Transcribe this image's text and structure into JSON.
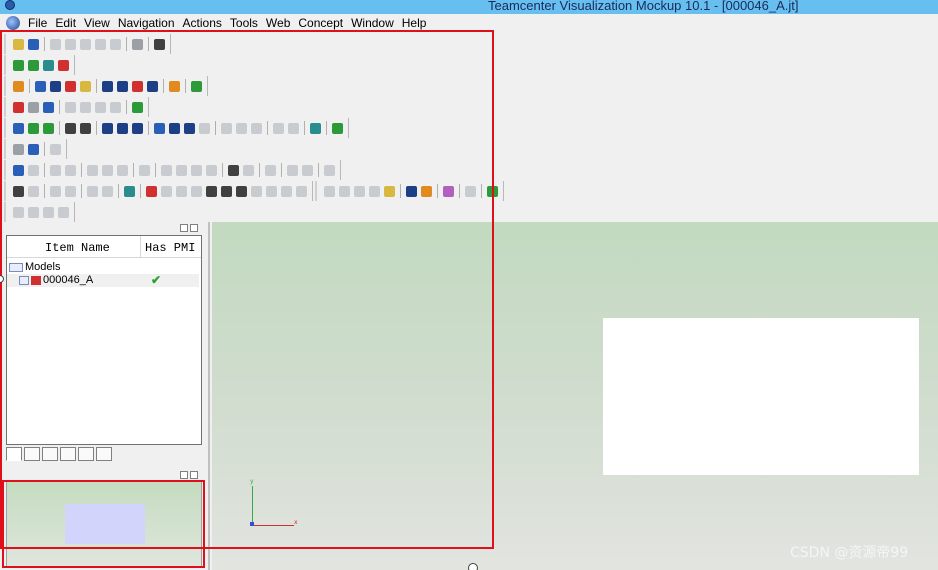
{
  "window": {
    "title": "Teamcenter Visualization Mockup 10.1 - [000046_A.jt]"
  },
  "menu": {
    "items": [
      "File",
      "Edit",
      "View",
      "Navigation",
      "Actions",
      "Tools",
      "Web",
      "Concept",
      "Window",
      "Help"
    ]
  },
  "tree": {
    "col_item_name": "Item Name",
    "col_has_pmi": "Has PMI",
    "root_label": "Models",
    "part_label": "000046_A",
    "pmi_check": "✔"
  },
  "viewport": {
    "watermark": "CSDN @资源帝99",
    "axis_y_label": "y",
    "axis_x_label": "x"
  },
  "colors": {
    "titlebar": "#67bff0",
    "annotation": "#e0101a",
    "viewport_top": "#c2dabf",
    "viewport_bottom": "#e2e4e0"
  }
}
